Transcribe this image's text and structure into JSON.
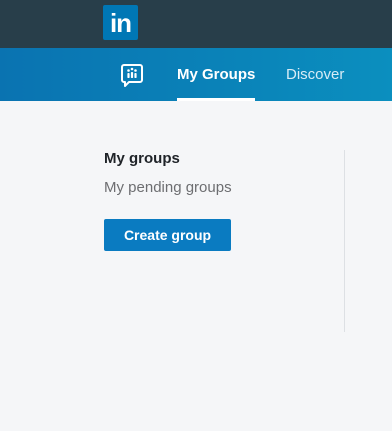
{
  "header": {
    "logo_text": "in",
    "logo_icon": "linkedin-logo",
    "background_color": "#283e4a"
  },
  "subnav": {
    "groups_icon": "groups-chat-icon",
    "tabs": [
      {
        "label": "My Groups",
        "active": true
      },
      {
        "label": "Discover",
        "active": false
      }
    ],
    "accent_color": "#0a73b1"
  },
  "main": {
    "title": "My groups",
    "pending_link": "My pending groups",
    "create_button": "Create group",
    "button_color": "#0a7bc1"
  }
}
